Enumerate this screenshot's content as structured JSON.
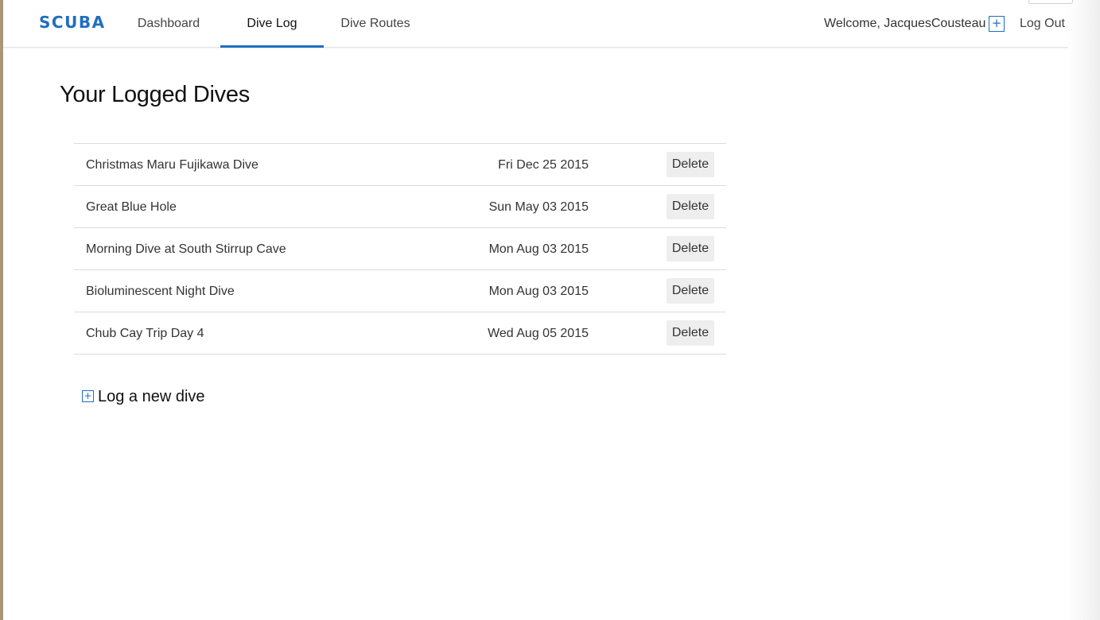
{
  "header": {
    "brand": "SCUBA",
    "nav": [
      {
        "label": "Dashboard",
        "active": false
      },
      {
        "label": "Dive Log",
        "active": true
      },
      {
        "label": "Dive Routes",
        "active": false
      }
    ],
    "welcome": "Welcome, JacquesCousteau",
    "add_icon": "plus-square-icon",
    "logout": "Log Out"
  },
  "main": {
    "title": "Your Logged Dives",
    "dives": [
      {
        "name": "Christmas Maru Fujikawa Dive",
        "date": "Fri Dec 25 2015",
        "action": "Delete"
      },
      {
        "name": "Great Blue Hole",
        "date": "Sun May 03 2015",
        "action": "Delete"
      },
      {
        "name": "Morning Dive at South Stirrup Cave",
        "date": "Mon Aug 03 2015",
        "action": "Delete"
      },
      {
        "name": "Bioluminescent Night Dive",
        "date": "Mon Aug 03 2015",
        "action": "Delete"
      },
      {
        "name": "Chub Cay Trip Day 4",
        "date": "Wed Aug 05 2015",
        "action": "Delete"
      }
    ],
    "new_dive": "Log a new dive"
  },
  "colors": {
    "accent": "#1f6fc0",
    "divider": "#dcdcdc",
    "button_bg": "#eeeeee"
  }
}
